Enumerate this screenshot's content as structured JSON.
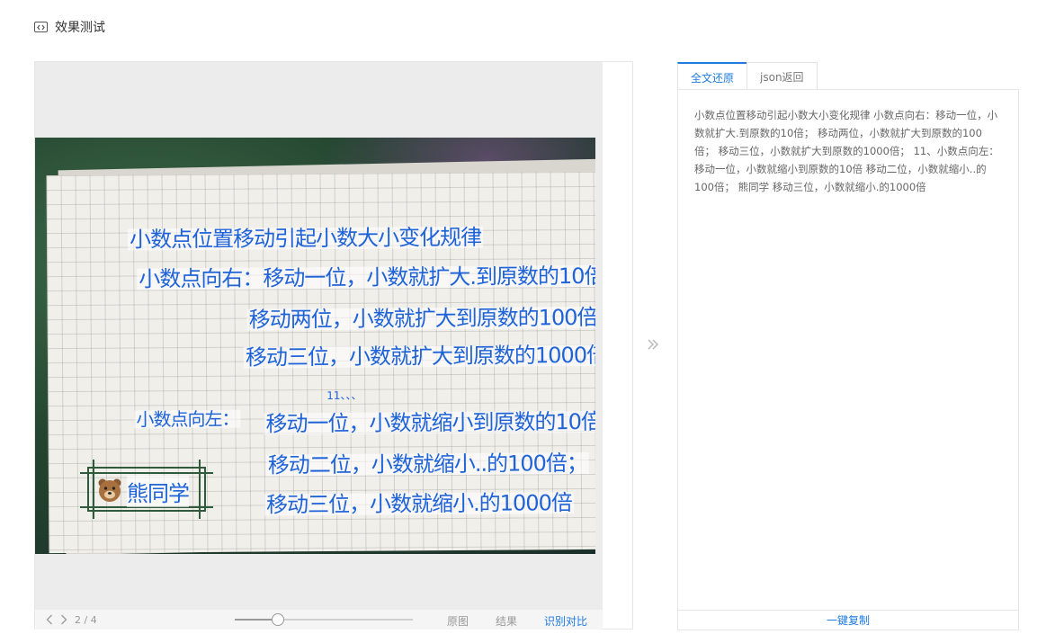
{
  "header": {
    "title": "效果测试",
    "icon": "code-icon"
  },
  "preview": {
    "ocr_lines": [
      "小数点位置移动引起小数大小变化规律",
      "小数点向右：移动一位，小数就扩大.到原数的10倍；",
      "移动两位，小数就扩大到原数的100倍；",
      "移动三位，小数就扩大到原数的1000倍；",
      "11、、、",
      "小数点向左：",
      "移动一位，小数就缩小到原数的10倍",
      "移动二位，小数就缩小..的100倍；",
      "移动三位，小数就缩小.的1000倍"
    ],
    "stamp_label": "熊同学"
  },
  "bottombar": {
    "page_indicator": "2 / 4",
    "zoom_fraction": 0.24,
    "options": [
      "原图",
      "结果",
      "识别对比"
    ],
    "active_option": "识别对比"
  },
  "tabs": [
    "全文还原",
    "json返回"
  ],
  "active_tab": "全文还原",
  "result": {
    "text": "小数点位置移动引起小数大小变化规律 小数点向右：移动一位，小数就扩大.到原数的10倍； 移动两位，小数就扩大到原数的100倍； 移动三位，小数就扩大到原数的1000倍； 11、小数点向左： 移动一位，小数就缩小到原数的10倍 移动二位，小数就缩小..的100倍； 熊同学 移动三位，小数就缩小.的1000倍"
  },
  "copy_button": "一键复制",
  "colors": {
    "accent": "#1f7be0",
    "ocr_text": "#1f63d9",
    "highlight": "#fff53c"
  }
}
